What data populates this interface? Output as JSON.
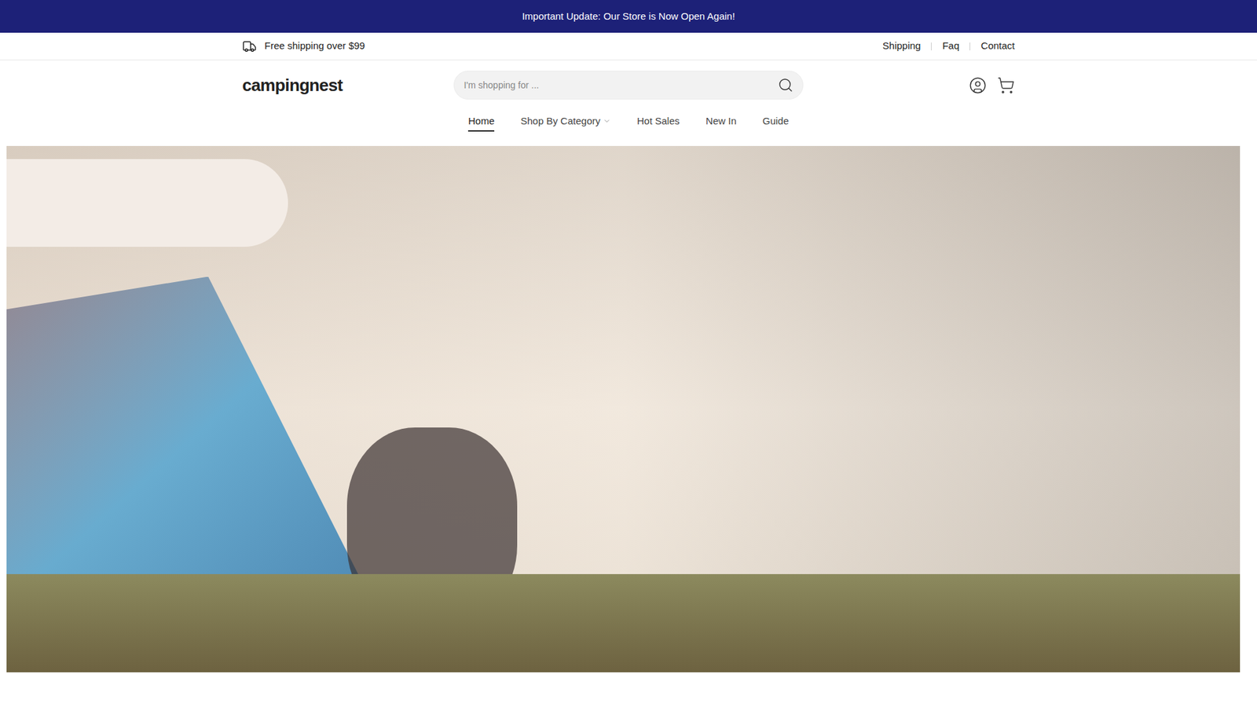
{
  "announcement": "Important Update: Our Store is Now Open Again!",
  "topbar": {
    "shipping_note": "Free shipping over $99",
    "links": [
      "Shipping",
      "Faq",
      "Contact"
    ]
  },
  "header": {
    "logo": "campingnest",
    "search": {
      "placeholder": "I'm shopping for ..."
    }
  },
  "nav": [
    {
      "label": "Home",
      "selected": true,
      "has_dropdown": false
    },
    {
      "label": "Shop By Category",
      "selected": false,
      "has_dropdown": true
    },
    {
      "label": "Hot Sales",
      "selected": false,
      "has_dropdown": false
    },
    {
      "label": "New In",
      "selected": false,
      "has_dropdown": false
    },
    {
      "label": "Guide",
      "selected": false,
      "has_dropdown": false
    }
  ]
}
